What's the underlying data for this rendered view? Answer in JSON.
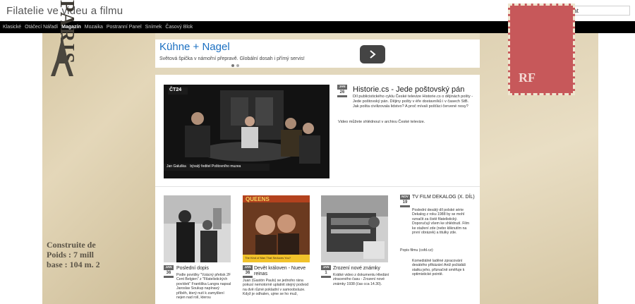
{
  "site": {
    "title": "Filatelie ve videu a filmu"
  },
  "search": {
    "value": "hledat"
  },
  "nav": {
    "items": [
      "Klasické",
      "Otáčecí Nářadí",
      "Magazín",
      "Mozaika",
      "Postranní Panel",
      "Snímek",
      "Časový Blok"
    ],
    "active": "Magazín"
  },
  "background": {
    "left_word": "PARIS",
    "left_caption": [
      "Construite de",
      "Poids : 7 mill",
      "base : 104 m. 2"
    ],
    "right_stamp_text": "RF"
  },
  "ad": {
    "title": "Kühne + Nagel",
    "desc": "Světová špička v námořní přepravě. Globální dosah i přímý servis!",
    "next_icon": "chevron-right-icon"
  },
  "featured": {
    "badge_month": "JAN",
    "badge_day": "26",
    "title": "Historie.cs - Jede poštovský pán",
    "summary": "Díl publicistického cyklu České televize Historie.cs o dějinách pošty - Jede poštovský pán. Dějiny pošty v éře dostavníků i v časech StB. Jak pošta civilizovala lidstvo? A proč mívali pošťáci červené nosy?",
    "note": "Video můžete shlédnout v archivu České televize.",
    "image_logo": "ČT24",
    "image_caption": "Jan Galuška    bývalý ředitel Poštovního muzea"
  },
  "cards": [
    {
      "badge_month": "JAN",
      "badge_day": "36",
      "title": "Poslední dopis",
      "text": "Podle povídky \"Vzácný přetisk 2F Cent Belgien\" z \"Filatelistických povídek\" Františka Langra napsal Jaroslav Soukup napínavý příběh, který nutí k zamyšlení nejen nad rolí, kterou"
    },
    {
      "badge_month": "JAN",
      "badge_day": "36",
      "title": "Devět královen - Nueve reinas",
      "text": "Juan (Gastón Pauls) se jednoho rána pokusí nemotorně uplatnit stejný podvod na dvě různé pokladní v samoobsluze. Když je odhalen, ujme se ho muž,",
      "poster_title": "QUEENS",
      "poster_caption": "The Kind of Man That Seduces You?"
    },
    {
      "badge_month": "JAN",
      "badge_day": "1",
      "title": "Zrození nové známky",
      "text": "Krátké video z dokumentu Hledání ztraceného času - Zrození nové známky 1938 (čas cca 14.30)."
    },
    {
      "badge_month": "NOV",
      "badge_day": "19",
      "title": "TV FILM DEKALOG (X. DÍL)",
      "text": "Poslední desátý díl polské série Dekalog z roku 1988 by se mohl označit za čistě filatelistický. Doporučují všem ke shlédnutí. Film ke stažení zde (nebo kliknutím na první obrázek) a titulky zde.",
      "label": "Popis filmu (csfd.cz):",
      "text2": "Komediálně laděné zpracování desátého přikázání Aniž požádáš statku jeho, přiznačně směřuje k optimistické pointě."
    }
  ]
}
